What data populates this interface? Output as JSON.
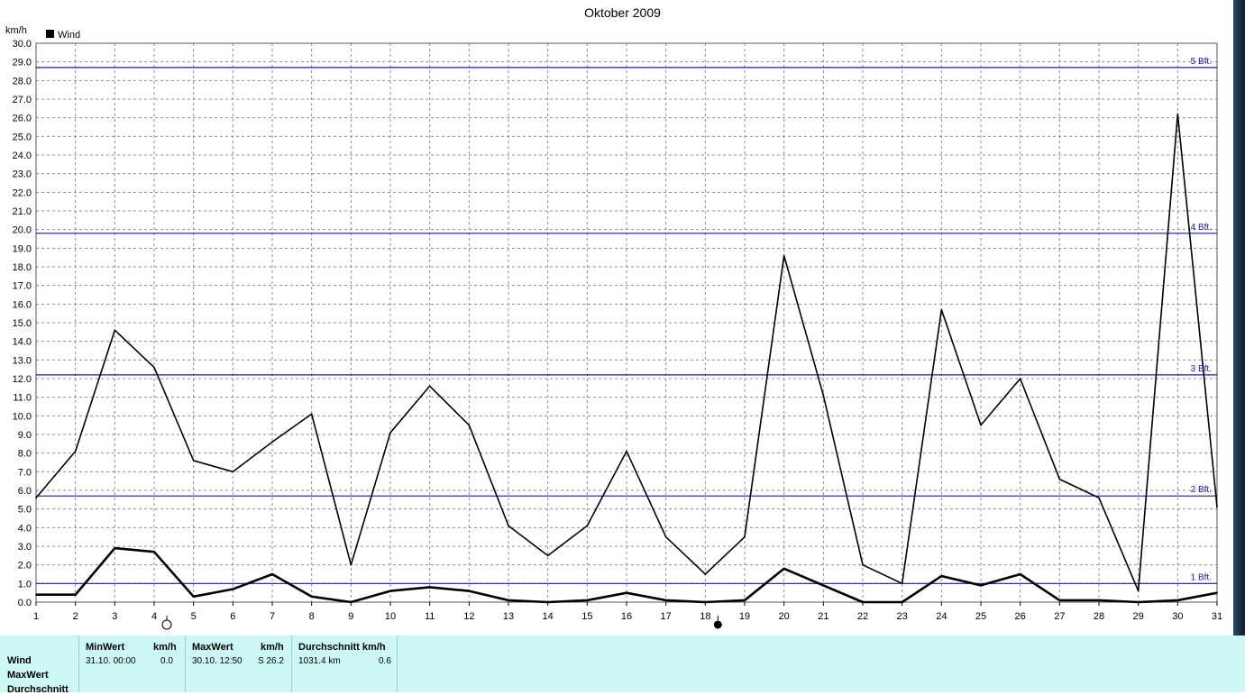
{
  "chart_data": {
    "type": "line",
    "title": "Oktober 2009",
    "ylabel": "km/h",
    "legend": {
      "label": "Wind",
      "placement": "top-left"
    },
    "ylim": [
      0,
      30
    ],
    "y_tick_step": 1,
    "x": [
      1,
      2,
      3,
      4,
      5,
      6,
      7,
      8,
      9,
      10,
      11,
      12,
      13,
      14,
      15,
      16,
      17,
      18,
      19,
      20,
      21,
      22,
      23,
      24,
      25,
      26,
      27,
      28,
      29,
      30,
      31
    ],
    "series": [
      {
        "values": [
          5.6,
          8.1,
          14.6,
          12.6,
          7.6,
          7.0,
          8.6,
          10.1,
          2.0,
          9.1,
          11.6,
          9.5,
          4.1,
          2.5,
          4.1,
          8.1,
          3.5,
          1.5,
          3.5,
          18.6,
          11.1,
          2.0,
          1.0,
          15.7,
          9.5,
          12.0,
          6.6,
          5.6,
          0.6,
          26.2,
          5.1
        ]
      },
      {
        "values": [
          0.4,
          0.4,
          2.9,
          2.7,
          0.3,
          0.7,
          1.5,
          0.3,
          0.0,
          0.6,
          0.8,
          0.6,
          0.1,
          0.0,
          0.1,
          0.5,
          0.1,
          0.0,
          0.1,
          1.8,
          0.9,
          0.0,
          0.0,
          1.4,
          0.9,
          1.5,
          0.1,
          0.1,
          0.0,
          0.1,
          0.5
        ]
      }
    ],
    "reference_lines": [
      {
        "label": "1 Bft.",
        "value": 1.0
      },
      {
        "label": "2 Bft.",
        "value": 5.7
      },
      {
        "label": "3 Bft.",
        "value": 12.2
      },
      {
        "label": "4 Bft.",
        "value": 19.8
      },
      {
        "label": "5 Bft.",
        "value": 28.7
      }
    ],
    "moon_phases": [
      {
        "day": 4,
        "phase": "full"
      },
      {
        "day": 18,
        "phase": "new"
      }
    ],
    "grid": true
  },
  "stats": {
    "rows": [
      "Wind",
      "MaxWert",
      "Durchschnitt"
    ],
    "min_header": "MinWert",
    "min_unit": "km/h",
    "min_date": "31.10.  00:00",
    "min_value": "0.0",
    "max_header": "MaxWert",
    "max_unit": "km/h",
    "max_date": "30.10.  12:50",
    "max_value": "S 26.2",
    "avg_header": "Durchschnitt km/h",
    "avg_distance": "1031.4 km",
    "avg_value": "0.6"
  },
  "colors": {
    "line": "#000000",
    "grid": "#8c8c8c",
    "reference": "#1a1aa6",
    "stats_bg": "#ccf7f4"
  }
}
